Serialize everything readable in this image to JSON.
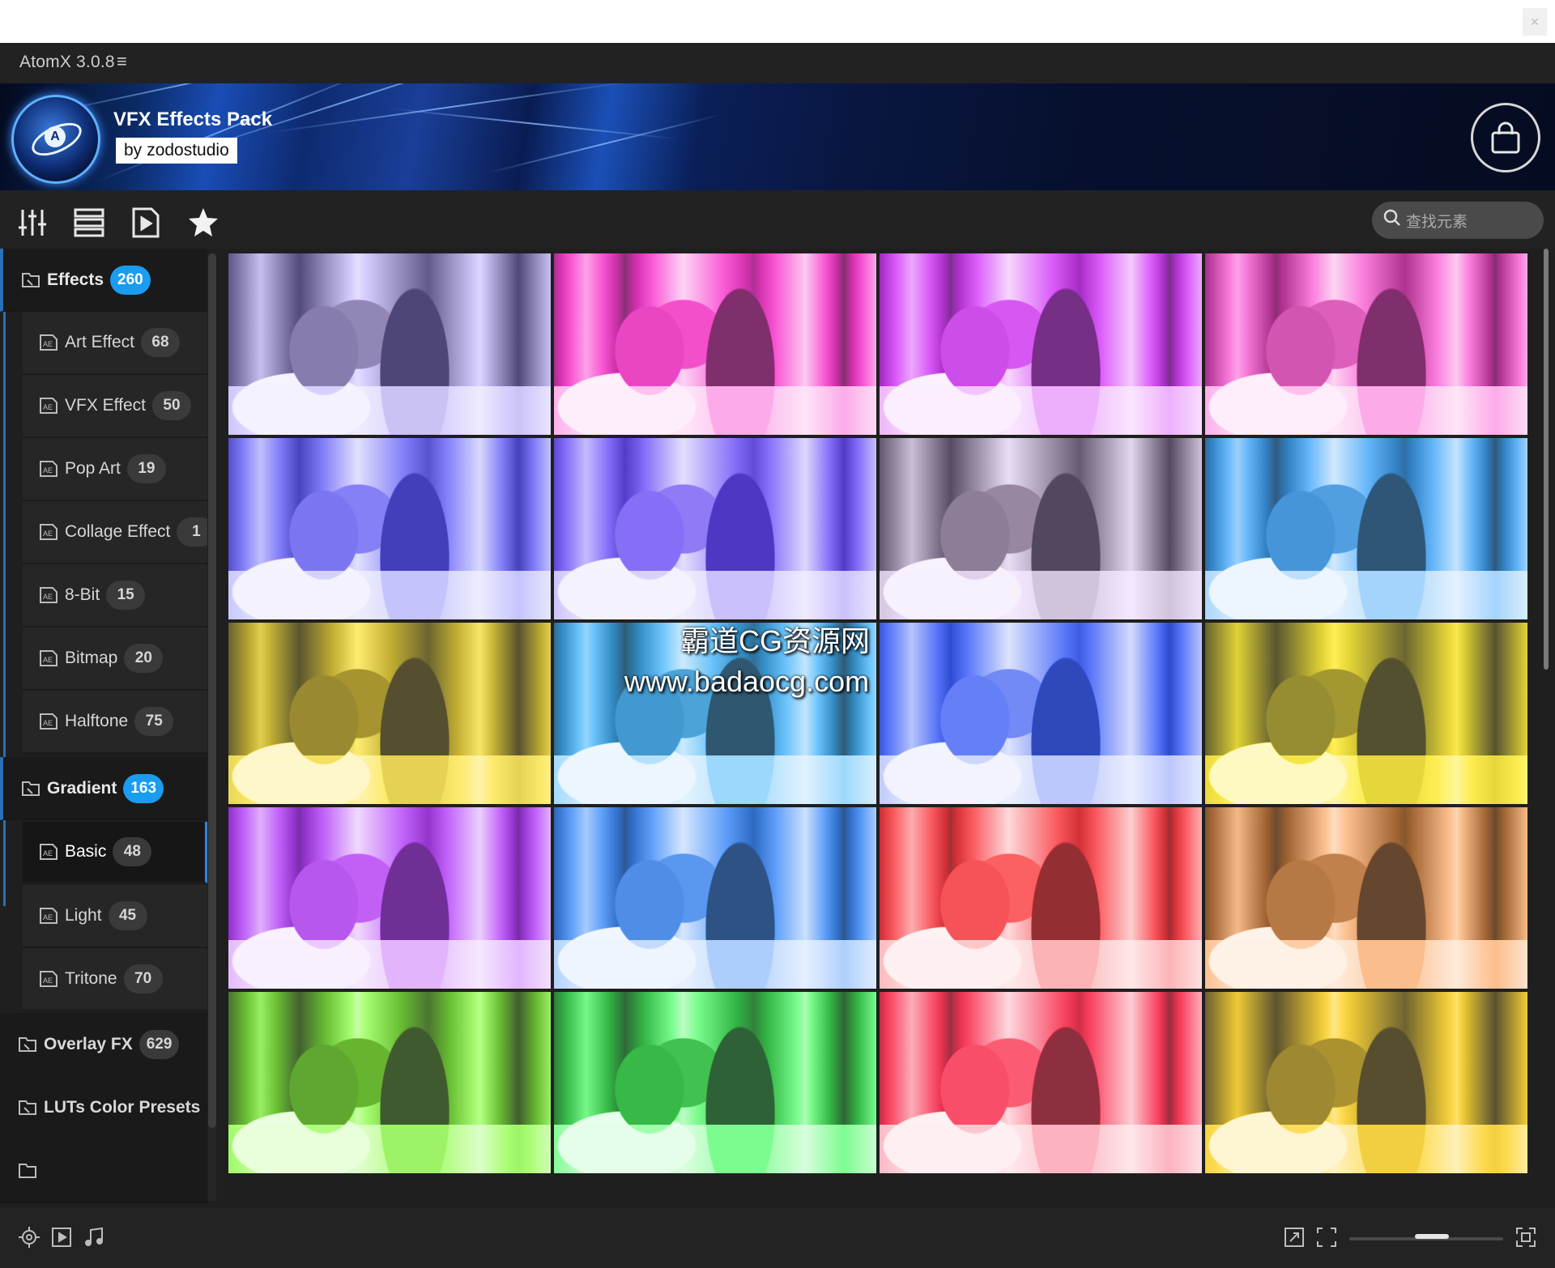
{
  "window": {
    "title": "AtomX 3.0.8",
    "menu_icon": "hamburger-icon",
    "close_icon": "close-icon"
  },
  "banner": {
    "title": "VFX Effects Pack",
    "by": "by",
    "author": "zodostudio",
    "cart_icon": "shopping-bag-icon"
  },
  "toolbar": {
    "icons": [
      "sliders-icon",
      "list-view-icon",
      "preview-play-icon",
      "favorites-star-icon"
    ],
    "search_placeholder": "查找元素"
  },
  "sidebar": {
    "groups": [
      {
        "label": "Effects",
        "count": "260",
        "expanded": true,
        "items": [
          {
            "label": "Art Effect",
            "count": "68"
          },
          {
            "label": "VFX Effect",
            "count": "50"
          },
          {
            "label": "Pop Art",
            "count": "19"
          },
          {
            "label": "Collage Effect",
            "count": "1"
          },
          {
            "label": "8-Bit",
            "count": "15"
          },
          {
            "label": "Bitmap",
            "count": "20"
          },
          {
            "label": "Halftone",
            "count": "75"
          }
        ]
      },
      {
        "label": "Gradient",
        "count": "163",
        "expanded": true,
        "items": [
          {
            "label": "Basic",
            "count": "48",
            "active": true
          },
          {
            "label": "Light",
            "count": "45"
          },
          {
            "label": "Tritone",
            "count": "70"
          }
        ]
      },
      {
        "label": "Overlay FX",
        "count": "629",
        "expanded": false
      },
      {
        "label": "LUTs Color Presets",
        "count": "",
        "expanded": false
      }
    ]
  },
  "grid": {
    "rows": 5,
    "cols": 4,
    "tints": [
      [
        "#6a5fa0",
        "#ff2fd0",
        "#d836ff",
        "#ff5fd8"
      ],
      [
        "#3f3ad8",
        "#6a4cff",
        "#7a6a8a",
        "#42a8ff"
      ],
      [
        "#d9c020",
        "#46b8ff",
        "#2f55ff",
        "#f5e21a"
      ],
      [
        "#b63cff",
        "#3a8cff",
        "#e81820",
        "#c87a3a"
      ],
      [
        "#6fdc2a",
        "#38e050",
        "#ff1a40",
        "#ffd21a"
      ]
    ]
  },
  "watermark": {
    "line1": "霸道CG资源网",
    "line2": "www.badaocg.com"
  },
  "footer": {
    "left_icons": [
      "target-icon",
      "video-icon",
      "music-icon"
    ],
    "right_icons": [
      "expand-icon",
      "fit-icon",
      "fullscreen-icon"
    ],
    "zoom_fraction": 0.55
  }
}
